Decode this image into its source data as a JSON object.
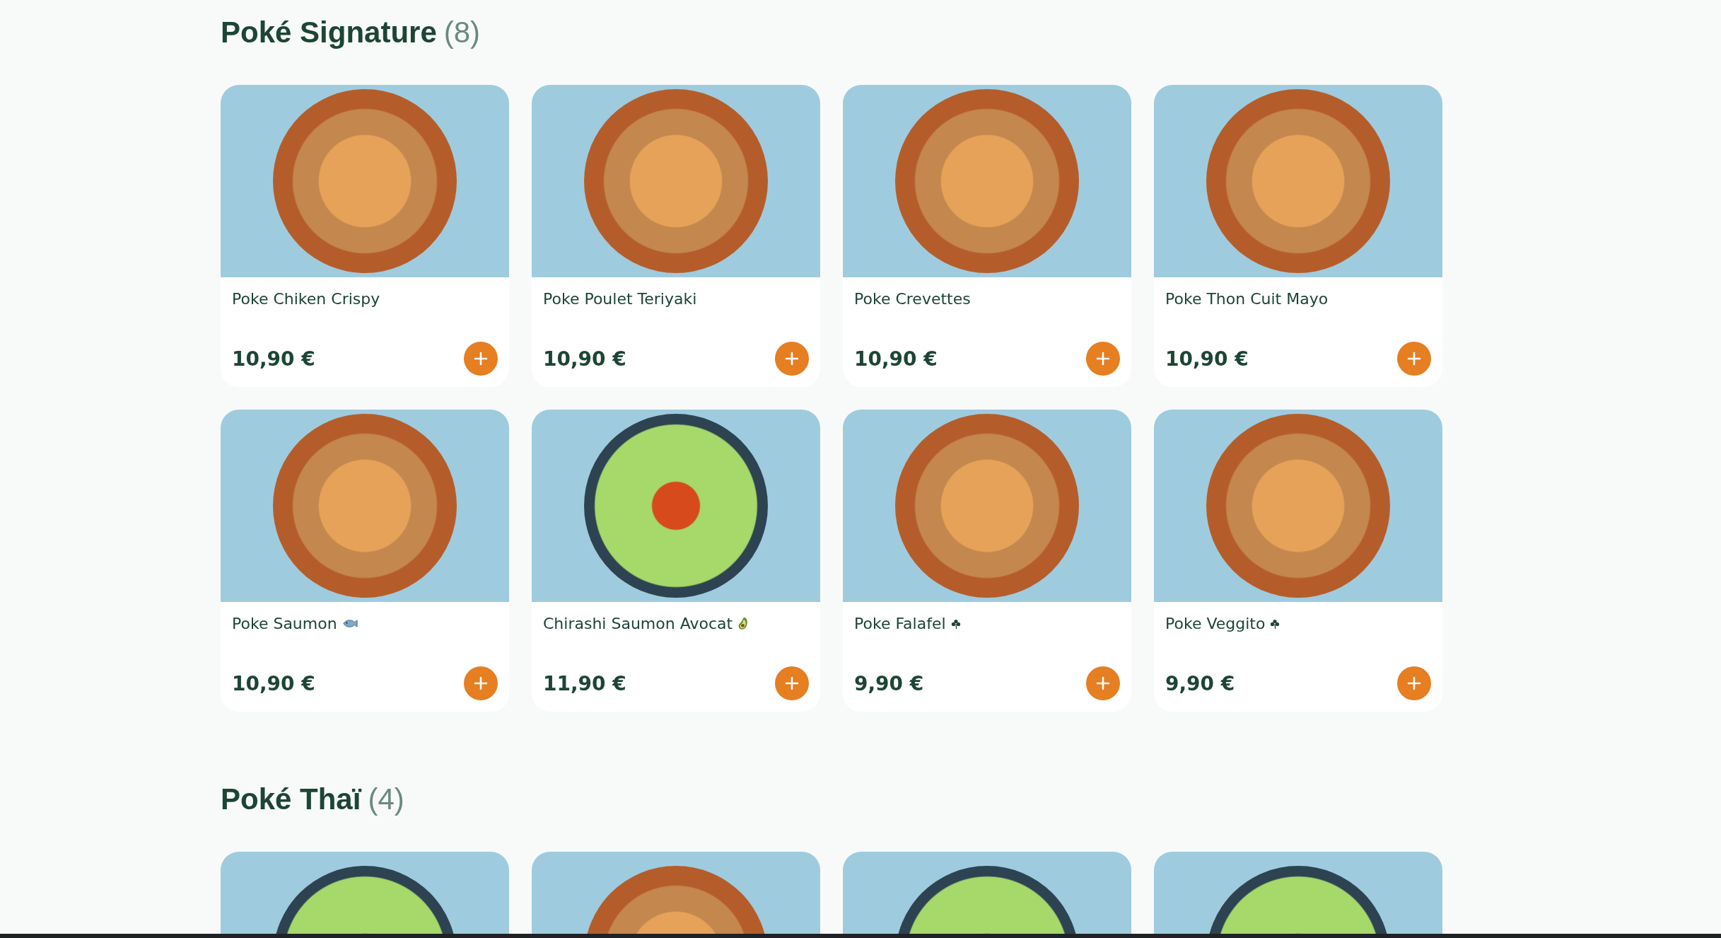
{
  "sections": [
    {
      "title": "Poké Signature",
      "count": "(8)",
      "products": [
        {
          "kind": "full",
          "name": "Poke Chiken Crispy",
          "price": "10,90 €",
          "photo": {
            "kind": "bowl"
          }
        },
        {
          "kind": "full",
          "name": "Poke Poulet Teriyaki",
          "price": "10,90 €",
          "photo": {
            "kind": "bowl"
          }
        },
        {
          "kind": "full",
          "name": "Poke Crevettes",
          "price": "10,90 €",
          "photo": {
            "kind": "bowl"
          }
        },
        {
          "kind": "full",
          "name": "Poke Thon Cuit Mayo",
          "price": "10,90 €",
          "photo": {
            "kind": "bowl"
          }
        },
        {
          "kind": "full",
          "name": "Poke Saumon",
          "symbol": {
            "kind": "fish"
          },
          "price": "10,90 €",
          "photo": {
            "kind": "bowl"
          }
        },
        {
          "kind": "full",
          "name": "Chirashi Saumon Avocat",
          "symbol": {
            "kind": "avocado"
          },
          "price": "11,90 €",
          "photo": {
            "kind": "plate"
          }
        },
        {
          "kind": "full",
          "name": "Poke Falafel",
          "symbol": {
            "kind": "shamrock"
          },
          "price": "9,90 €",
          "photo": {
            "kind": "bowl"
          }
        },
        {
          "kind": "full",
          "name": "Poke Veggito",
          "symbol": {
            "kind": "shamrock"
          },
          "price": "9,90 €",
          "photo": {
            "kind": "bowl"
          }
        }
      ]
    },
    {
      "title": "Poké Thaï",
      "count": "(4)",
      "products": [
        {
          "kind": "photo-only",
          "photo": {
            "kind": "plate"
          }
        },
        {
          "kind": "photo-only",
          "photo": {
            "kind": "bowl"
          }
        },
        {
          "kind": "photo-only",
          "photo": {
            "kind": "plate"
          }
        },
        {
          "kind": "photo-only",
          "photo": {
            "kind": "plate"
          }
        }
      ]
    }
  ]
}
